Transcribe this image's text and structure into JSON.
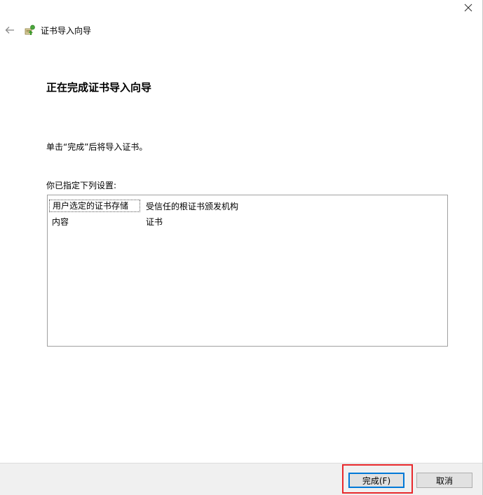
{
  "window": {
    "title": "证书导入向导"
  },
  "main": {
    "heading": "正在完成证书导入向导",
    "instruction": "单击“完成”后将导入证书。",
    "settings_label": "你已指定下列设置:",
    "settings": [
      {
        "key": "用户选定的证书存储",
        "value": "受信任的根证书颁发机构"
      },
      {
        "key": "内容",
        "value": "证书"
      }
    ]
  },
  "footer": {
    "finish_label": "完成(F)",
    "cancel_label": "取消"
  },
  "icons": {
    "close": "close-icon",
    "back": "back-arrow-icon",
    "wizard": "certificate-wizard-icon"
  },
  "colors": {
    "highlight": "#e8282b",
    "default_button_border": "#0078d7",
    "footer_bg": "#f0f0f0"
  }
}
